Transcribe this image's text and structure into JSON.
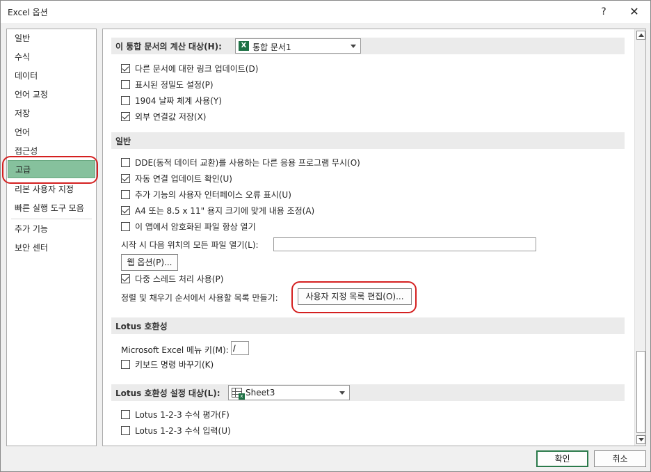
{
  "window": {
    "title": "Excel 옵션",
    "help": "?",
    "close": "✕"
  },
  "sidebar": {
    "items": [
      {
        "label": "일반"
      },
      {
        "label": "수식"
      },
      {
        "label": "데이터"
      },
      {
        "label": "언어 교정"
      },
      {
        "label": "저장"
      },
      {
        "label": "언어"
      },
      {
        "label": "접근성"
      },
      {
        "label": "고급"
      },
      {
        "label": "리본 사용자 지정"
      },
      {
        "label": "빠른 실행 도구 모음"
      },
      {
        "label": "추가 기능"
      },
      {
        "label": "보안 센터"
      }
    ],
    "selected": "고급"
  },
  "calc_section": {
    "header": "이 통합 문서의 계산 대상(H):",
    "workbook_combo": "통합 문서1",
    "options": [
      {
        "label": "다른 문서에 대한 링크 업데이트(D)",
        "checked": true
      },
      {
        "label": "표시된 정밀도 설정(P)",
        "checked": false
      },
      {
        "label": "1904 날짜 체계 사용(Y)",
        "checked": false
      },
      {
        "label": "외부 연결값 저장(X)",
        "checked": true
      }
    ]
  },
  "general_section": {
    "header": "일반",
    "options": [
      {
        "label": "DDE(동적 데이터 교환)를 사용하는 다른 응용 프로그램 무시(O)",
        "checked": false
      },
      {
        "label": "자동 연결 업데이트 확인(U)",
        "checked": true
      },
      {
        "label": "추가 기능의 사용자 인터페이스 오류 표시(U)",
        "checked": false
      },
      {
        "label": "A4 또는 8.5 x 11\" 용지 크기에 맞게 내용 조정(A)",
        "checked": true
      },
      {
        "label": "이 앱에서 암호화된 파일 항상 열기",
        "checked": false
      }
    ],
    "startup_label": "시작 시 다음 위치의 모든 파일 열기(L):",
    "startup_value": "",
    "web_options_button": "웹 옵션(P)...",
    "multithread": {
      "label": "다중 스레드 처리 사용(P)",
      "checked": true
    },
    "custom_list_label": "정렬 및 채우기 순서에서 사용할 목록 만들기:",
    "custom_list_button": "사용자 지정 목록 편집(O)..."
  },
  "lotus_section": {
    "header": "Lotus 호환성",
    "menu_key_label": "Microsoft Excel 메뉴 키(M):",
    "menu_key_value": "/",
    "nav_keys": {
      "label": "키보드 명령 바꾸기(K)",
      "checked": false
    }
  },
  "lotus_settings_section": {
    "header": "Lotus 호환성 설정 대상(L):",
    "sheet_combo": "Sheet3",
    "options": [
      {
        "label": "Lotus 1-2-3 수식 평가(F)",
        "checked": false
      },
      {
        "label": "Lotus 1-2-3 수식 입력(U)",
        "checked": false
      }
    ]
  },
  "footer": {
    "ok": "확인",
    "cancel": "취소"
  },
  "colors": {
    "selected_nav": "#86c19d",
    "highlight": "#d42020",
    "excel_green": "#1e7145"
  }
}
